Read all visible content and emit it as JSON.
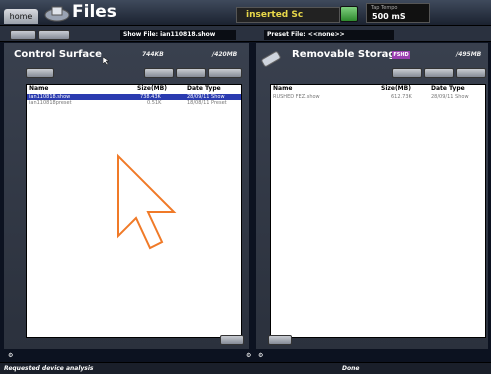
{
  "topbar": {
    "home_label": "home",
    "title": "Files",
    "status_text": "inserted Sc",
    "time_label": "Tap Tempo",
    "time_value": "500 mS"
  },
  "subbar": {
    "show_file": "Show File: ian110818.show",
    "preset_file": "Preset File: <<none>>"
  },
  "left_panel": {
    "title": "Control Surface",
    "used": "744KB",
    "total": "/420MB",
    "columns": [
      "Name",
      "Size(MB)",
      "Date Type"
    ],
    "rows": [
      {
        "name": "ian110818.show",
        "size": "738.43K",
        "date": "28/09/11 Show",
        "selected": true
      },
      {
        "name": "ian110818preset",
        "size": "0.51K",
        "date": "18/08/11 Preset",
        "selected": false
      }
    ]
  },
  "right_panel": {
    "title": "Removable Storage",
    "badge": "FSHD",
    "total": "/495MB",
    "columns": [
      "Name",
      "Size(MB)",
      "Date Type"
    ],
    "rows": [
      {
        "name": "RUSHED FEZ.show",
        "size": "612.73K",
        "date": "28/09/11 Show",
        "selected": false
      }
    ]
  },
  "statusbar": {
    "left": "Requested device analysis",
    "mid": "Done"
  },
  "colors": {
    "selection": "#2a3bb0",
    "status_text": "#e8d84a",
    "cursor_outline": "#f07a28"
  }
}
